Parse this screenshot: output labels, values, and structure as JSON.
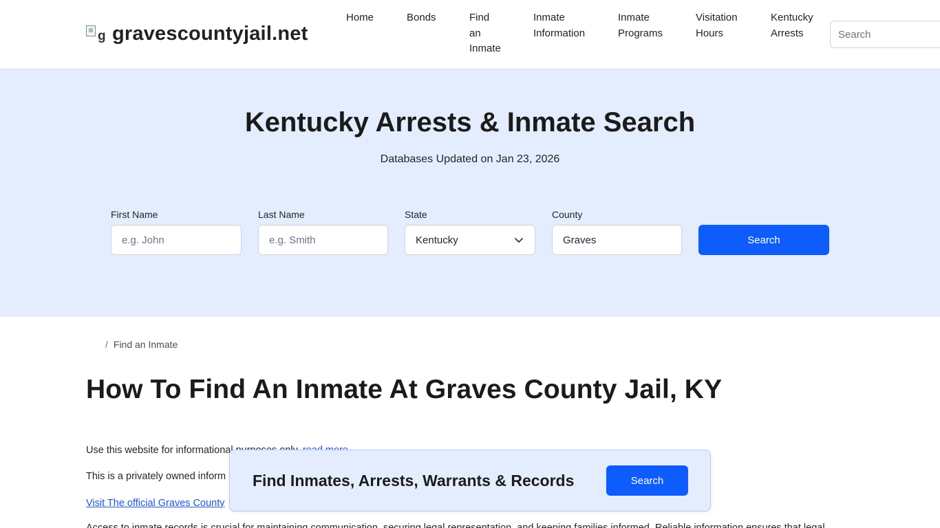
{
  "header": {
    "logo_alt": "g",
    "site_name": "gravescountyjail.net",
    "nav": [
      {
        "lines": [
          "Home"
        ]
      },
      {
        "lines": [
          "Bonds"
        ]
      },
      {
        "lines": [
          "Find",
          "an",
          "Inmate"
        ]
      },
      {
        "lines": [
          "Inmate",
          "Information"
        ]
      },
      {
        "lines": [
          "Inmate",
          "Programs"
        ]
      },
      {
        "lines": [
          "Visitation",
          "Hours"
        ]
      },
      {
        "lines": [
          "Kentucky",
          "Arrests"
        ]
      }
    ],
    "search_placeholder": "Search"
  },
  "hero": {
    "title": "Kentucky Arrests & Inmate Search",
    "updated": "Databases Updated on Jan 23, 2026",
    "first_name_label": "First Name",
    "first_name_placeholder": "e.g. John",
    "last_name_label": "Last Name",
    "last_name_placeholder": "e.g. Smith",
    "state_label": "State",
    "state_value": "Kentucky",
    "county_label": "County",
    "county_value": "Graves",
    "search_label": "Search"
  },
  "breadcrumb": {
    "separator": "/",
    "current": "Find an Inmate"
  },
  "main": {
    "title": "How To Find An Inmate At Graves County Jail, KY",
    "para1": "Use this website for informational purposes only.",
    "para1_link": "read more",
    "para2": "This is a privately owned inform",
    "para3_link": "Visit The official Graves County",
    "para4": "Access to inmate records is crucial for maintaining communication, securing legal representation, and keeping families informed. Reliable information ensures that legal"
  },
  "banner": {
    "text": "Find Inmates, Arrests, Warrants & Records",
    "button": "Search"
  },
  "colors": {
    "accent": "#0d5cfb",
    "hero_bg": "#e4edfd",
    "link": "#1a55d6"
  }
}
